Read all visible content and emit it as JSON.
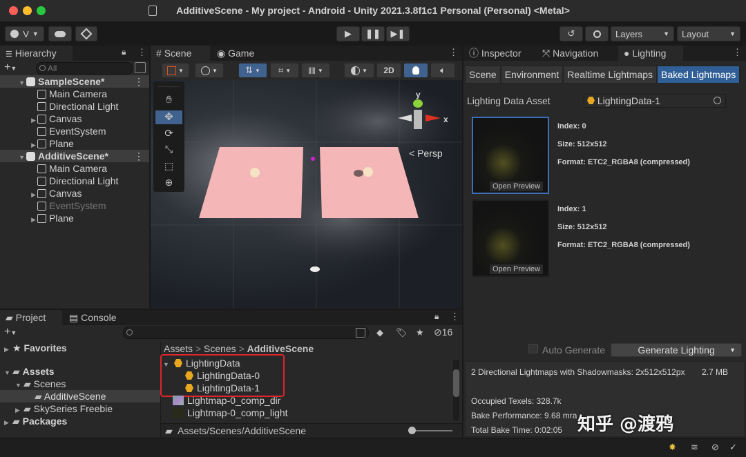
{
  "window": {
    "title": "AdditiveScene - My project - Android - Unity 2021.3.8f1c1 Personal (Personal) <Metal>"
  },
  "toolbar": {
    "account_label": "V",
    "layers_label": "Layers",
    "layout_label": "Layout"
  },
  "hierarchy": {
    "tab_label": "Hierarchy",
    "search_placeholder": "All",
    "items": [
      {
        "label": "SampleScene*",
        "kind": "scene"
      },
      {
        "label": "Main Camera",
        "kind": "obj"
      },
      {
        "label": "Directional Light",
        "kind": "obj"
      },
      {
        "label": "Canvas",
        "kind": "obj"
      },
      {
        "label": "EventSystem",
        "kind": "obj"
      },
      {
        "label": "Plane",
        "kind": "obj"
      },
      {
        "label": "AdditiveScene*",
        "kind": "scene"
      },
      {
        "label": "Main Camera",
        "kind": "obj"
      },
      {
        "label": "Directional Light",
        "kind": "obj"
      },
      {
        "label": "Canvas",
        "kind": "obj"
      },
      {
        "label": "EventSystem",
        "kind": "obj-disabled"
      },
      {
        "label": "Plane",
        "kind": "obj"
      }
    ]
  },
  "scene_view": {
    "tabs": [
      "Scene",
      "Game"
    ],
    "mode_2d": "2D",
    "gizmo": {
      "y": "y",
      "x": "x",
      "persp": "< Persp"
    }
  },
  "inspector": {
    "tabs": [
      "Inspector",
      "Navigation",
      "Lighting"
    ],
    "subtabs": [
      "Scene",
      "Environment",
      "Realtime Lightmaps",
      "Baked Lightmaps"
    ],
    "lighting_data_asset_label": "Lighting Data Asset",
    "lighting_data_asset_value": "LightingData-1",
    "lightmaps": [
      {
        "index": "Index: 0",
        "size": "Size: 512x512",
        "format": "Format: ETC2_RGBA8 (compressed)",
        "preview": "Open Preview"
      },
      {
        "index": "Index: 1",
        "size": "Size: 512x512",
        "format": "Format: ETC2_RGBA8 (compressed)",
        "preview": "Open Preview"
      }
    ],
    "auto_generate_label": "Auto Generate",
    "generate_label": "Generate Lighting",
    "stats": {
      "summary": "2 Directional Lightmaps with Shadowmasks: 2x512x512px",
      "size": "2.7 MB",
      "occupied": "Occupied Texels: 328.7k",
      "performance": "Bake Performance: 9.68 mra",
      "total": "Total Bake Time: 0:02:05"
    }
  },
  "project": {
    "tabs": [
      "Project",
      "Console"
    ],
    "hidden_count": "16",
    "tree": [
      {
        "label": "Favorites",
        "level": 0,
        "bold": true
      },
      {
        "label": "Assets",
        "level": 0,
        "bold": true
      },
      {
        "label": "Scenes",
        "level": 1,
        "bold": false
      },
      {
        "label": "AdditiveScene",
        "level": 2,
        "bold": false
      },
      {
        "label": "SkySeries Freebie",
        "level": 1,
        "bold": false
      },
      {
        "label": "Packages",
        "level": 0,
        "bold": true
      }
    ],
    "breadcrumb": [
      "Assets",
      "Scenes",
      "AdditiveScene"
    ],
    "files": [
      {
        "label": "LightingData",
        "indent": 0
      },
      {
        "label": "LightingData-0",
        "indent": 1
      },
      {
        "label": "LightingData-1",
        "indent": 1
      },
      {
        "label": "Lightmap-0_comp_dir",
        "indent": 0
      },
      {
        "label": "Lightmap-0_comp_light",
        "indent": 0
      }
    ],
    "path": "Assets/Scenes/AdditiveScene"
  },
  "watermark": "知乎 @渡鸦",
  "colors": {
    "accent": "#2f5f96",
    "highlight_box": "#e0252b",
    "plane": "#f4b6b6"
  }
}
